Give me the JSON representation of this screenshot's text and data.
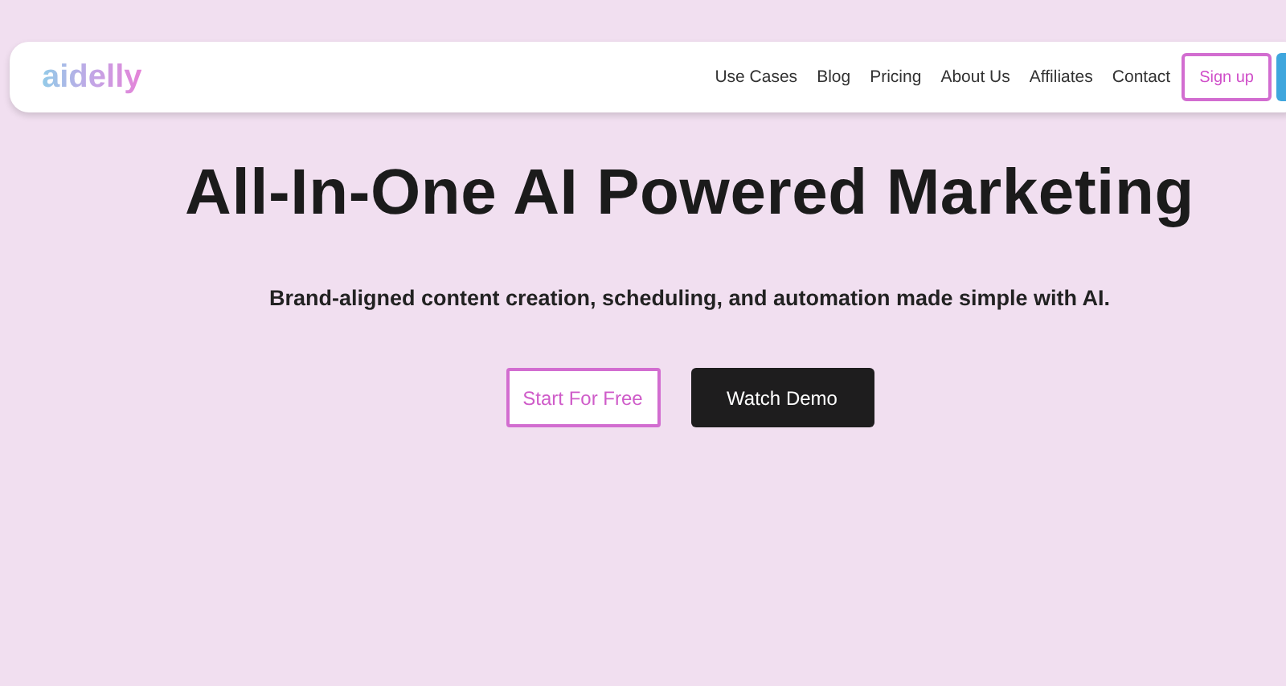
{
  "nav": {
    "logo": "aidelly",
    "links": [
      {
        "label": "Use Cases"
      },
      {
        "label": "Blog"
      },
      {
        "label": "Pricing"
      },
      {
        "label": "About Us"
      },
      {
        "label": "Affiliates"
      },
      {
        "label": "Contact"
      }
    ],
    "signup": "Sign up"
  },
  "hero": {
    "title": "All-In-One AI Powered Marketing",
    "subtitle": "Brand-aligned content creation, scheduling, and automation made simple with AI.",
    "buttons": [
      {
        "label": "Start For Free",
        "kind": "outline"
      },
      {
        "label": "Watch Demo",
        "kind": "dark"
      }
    ]
  }
}
